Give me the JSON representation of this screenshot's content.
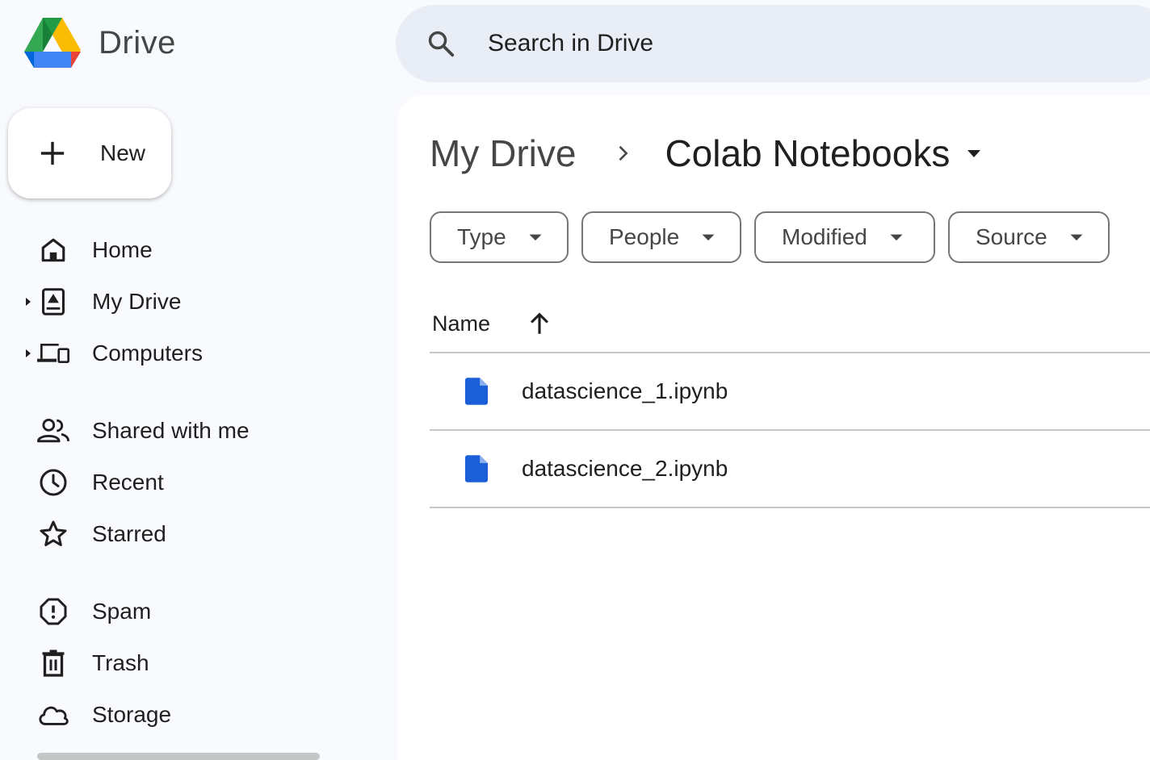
{
  "app": {
    "name": "Drive",
    "colors": {
      "accent": "#0b57d0",
      "file_icon": "#1a5fd8",
      "background": "#f8fafd",
      "search_bg": "#e9eef6"
    }
  },
  "search": {
    "placeholder": "Search in Drive",
    "value": ""
  },
  "new_button": {
    "label": "New"
  },
  "sidebar": {
    "items": [
      {
        "label": "Home",
        "icon": "home-icon"
      },
      {
        "label": "My Drive",
        "icon": "my-drive-icon",
        "expandable": true
      },
      {
        "label": "Computers",
        "icon": "computers-icon",
        "expandable": true
      },
      {
        "label": "Shared with me",
        "icon": "shared-people-icon"
      },
      {
        "label": "Recent",
        "icon": "clock-icon"
      },
      {
        "label": "Starred",
        "icon": "star-icon"
      },
      {
        "label": "Spam",
        "icon": "spam-icon"
      },
      {
        "label": "Trash",
        "icon": "trash-icon"
      },
      {
        "label": "Storage",
        "icon": "cloud-icon"
      }
    ]
  },
  "breadcrumb": {
    "root": "My Drive",
    "current": "Colab Notebooks"
  },
  "filters": [
    "Type",
    "People",
    "Modified",
    "Source"
  ],
  "list": {
    "header": {
      "name": "Name",
      "sort": "ascending"
    },
    "files": [
      {
        "name": "datascience_1.ipynb",
        "icon": "document-icon"
      },
      {
        "name": "datascience_2.ipynb",
        "icon": "document-icon"
      }
    ]
  }
}
